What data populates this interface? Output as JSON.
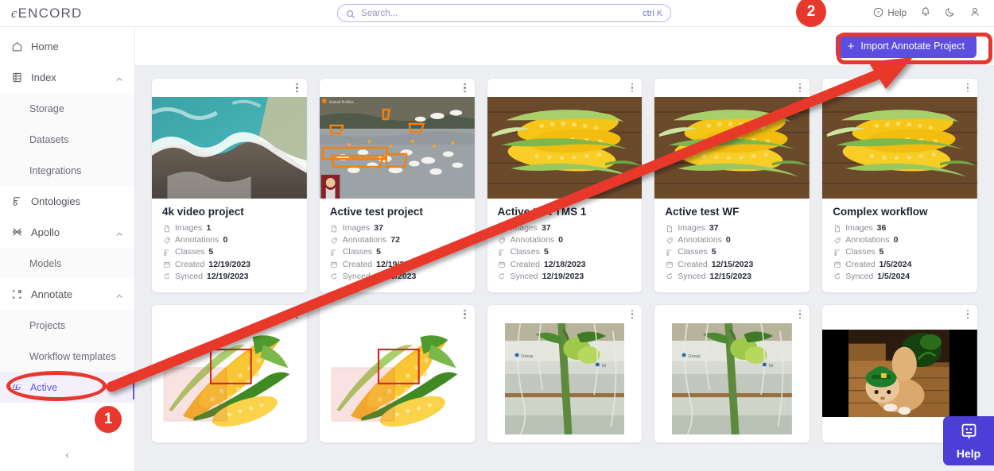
{
  "brand": {
    "name": "ENCORD"
  },
  "search": {
    "placeholder": "Search...",
    "shortcut": "ctrl K"
  },
  "topbar_actions": [
    {
      "label": "Help",
      "icon": "help-circle-icon"
    },
    {
      "label": "",
      "icon": "bell-icon"
    },
    {
      "label": "",
      "icon": "moon-icon"
    },
    {
      "label": "",
      "icon": "user-icon"
    }
  ],
  "sidebar": {
    "items": [
      {
        "label": "Home",
        "icon": "home-icon",
        "type": "top",
        "expandable": false
      },
      {
        "label": "Index",
        "icon": "index-icon",
        "type": "top",
        "expandable": true
      },
      {
        "label": "Storage",
        "icon": "",
        "type": "sub",
        "active": false
      },
      {
        "label": "Datasets",
        "icon": "",
        "type": "sub",
        "active": false
      },
      {
        "label": "Integrations",
        "icon": "",
        "type": "sub",
        "active": false
      },
      {
        "label": "Ontologies",
        "icon": "ontology-icon",
        "type": "top",
        "expandable": false
      },
      {
        "label": "Apollo",
        "icon": "apollo-icon",
        "type": "top",
        "expandable": true
      },
      {
        "label": "Models",
        "icon": "",
        "type": "sub",
        "active": false
      },
      {
        "label": "Annotate",
        "icon": "annotate-icon",
        "type": "top",
        "expandable": true
      },
      {
        "label": "Projects",
        "icon": "",
        "type": "sub",
        "active": false
      },
      {
        "label": "Workflow templates",
        "icon": "",
        "type": "sub",
        "active": false
      },
      {
        "label": "Active",
        "icon": "active-icon",
        "type": "sub",
        "active": true
      }
    ],
    "collapse_label": "‹"
  },
  "main": {
    "import_button": {
      "label": "Import Annotate Project",
      "plus": "+"
    }
  },
  "cards": [
    {
      "title": "4k video project",
      "thumb": "aerial-coastline",
      "meta": [
        {
          "icon": "file-icon",
          "label": "Images",
          "value": "1"
        },
        {
          "icon": "tag-icon",
          "label": "Annotations",
          "value": "0"
        },
        {
          "icon": "classes-icon",
          "label": "Classes",
          "value": "5"
        },
        {
          "icon": "calendar-icon",
          "label": "Created",
          "value": "12/19/2023"
        },
        {
          "icon": "sync-icon",
          "label": "Synced",
          "value": "12/19/2023"
        }
      ]
    },
    {
      "title": "Active test project",
      "thumb": "geese-river",
      "meta": [
        {
          "icon": "file-icon",
          "label": "Images",
          "value": "37"
        },
        {
          "icon": "tag-icon",
          "label": "Annotations",
          "value": "72"
        },
        {
          "icon": "classes-icon",
          "label": "Classes",
          "value": "5"
        },
        {
          "icon": "calendar-icon",
          "label": "Created",
          "value": "12/19/2023"
        },
        {
          "icon": "sync-icon",
          "label": "Synced",
          "value": "12/19/2023"
        }
      ]
    },
    {
      "title": "Active test TMS 1",
      "thumb": "corn-wood",
      "meta": [
        {
          "icon": "file-icon",
          "label": "Images",
          "value": "37"
        },
        {
          "icon": "tag-icon",
          "label": "Annotations",
          "value": "0"
        },
        {
          "icon": "classes-icon",
          "label": "Classes",
          "value": "5"
        },
        {
          "icon": "calendar-icon",
          "label": "Created",
          "value": "12/18/2023"
        },
        {
          "icon": "sync-icon",
          "label": "Synced",
          "value": "12/19/2023"
        }
      ]
    },
    {
      "title": "Active test WF",
      "thumb": "corn-wood",
      "meta": [
        {
          "icon": "file-icon",
          "label": "Images",
          "value": "37"
        },
        {
          "icon": "tag-icon",
          "label": "Annotations",
          "value": "0"
        },
        {
          "icon": "classes-icon",
          "label": "Classes",
          "value": "5"
        },
        {
          "icon": "calendar-icon",
          "label": "Created",
          "value": "12/15/2023"
        },
        {
          "icon": "sync-icon",
          "label": "Synced",
          "value": "12/15/2023"
        }
      ]
    },
    {
      "title": "Complex workflow",
      "thumb": "corn-wood",
      "meta": [
        {
          "icon": "file-icon",
          "label": "Images",
          "value": "36"
        },
        {
          "icon": "tag-icon",
          "label": "Annotations",
          "value": "0"
        },
        {
          "icon": "classes-icon",
          "label": "Classes",
          "value": "5"
        },
        {
          "icon": "calendar-icon",
          "label": "Created",
          "value": "1/5/2024"
        },
        {
          "icon": "sync-icon",
          "label": "Synced",
          "value": "1/5/2024"
        }
      ]
    }
  ],
  "cards_row2": [
    {
      "thumb": "corn-boxes"
    },
    {
      "thumb": "corn-boxes"
    },
    {
      "thumb": "tomato-greenhouse"
    },
    {
      "thumb": "tomato-greenhouse"
    },
    {
      "thumb": "kitten-hat"
    }
  ],
  "help_widget": {
    "label": "Help",
    "icon": "chat-face-icon"
  },
  "annotations": {
    "step_one": "1",
    "step_two": "2",
    "accent_color": "#e8372c"
  },
  "colors": {
    "primary": "#5b4ee0",
    "sidebar_active_bg": "#f3f0fc",
    "sidebar_active_text": "#6558e6",
    "grid_bg": "#eceef2",
    "annotation_red": "#e8372c"
  }
}
